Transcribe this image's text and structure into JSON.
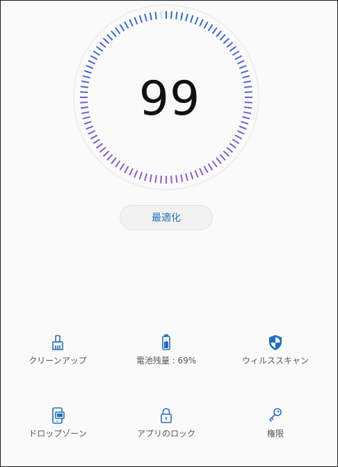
{
  "score": {
    "value": "99",
    "progress_percent": 99
  },
  "optimize_button": {
    "label": "最適化"
  },
  "tools": [
    {
      "label": "クリーンアップ",
      "icon": "broom-icon"
    },
    {
      "label": "電池残量 : 69%",
      "icon": "battery-icon"
    },
    {
      "label": "ウィルススキャン",
      "icon": "shield-icon"
    },
    {
      "label": "ドロップゾーン",
      "icon": "dropzone-icon"
    },
    {
      "label": "アプリのロック",
      "icon": "lock-icon"
    },
    {
      "label": "権限",
      "icon": "key-icon"
    }
  ],
  "colors": {
    "accent": "#1f6fc1",
    "gauge_tick_start": "#2f67d8",
    "gauge_tick_end": "#8a5ec9",
    "gauge_track": "#d8d8d8"
  }
}
